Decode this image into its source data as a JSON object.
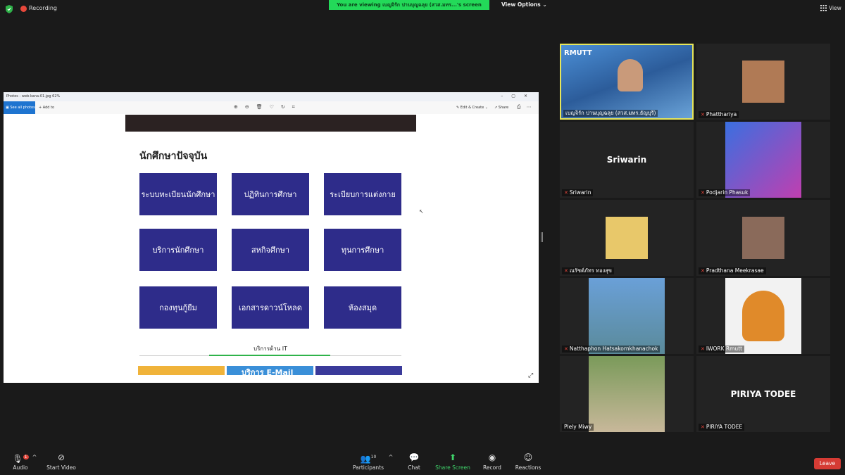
{
  "topbar": {
    "recording_label": "Recording",
    "viewing_text": "You are viewing เบญจิรัก ปานบุญฉลุย (สวส.มทร...'s screen",
    "view_options_label": "View Options",
    "view_label": "View"
  },
  "shared_window": {
    "title": "Photos - web-kana-01.jpg   62%",
    "toolbar": {
      "see_all_photos": "See all photos",
      "add_to": "Add to",
      "edit_create": "Edit & Create",
      "share": "Share"
    },
    "section_title": "นักศึกษาปัจจุบัน",
    "tiles": [
      "ระบบทะเบียนนักศึกษา",
      "ปฏิทินการศึกษา",
      "ระเบียบการแต่งกาย",
      "บริการนักศึกษา",
      "สหกิจศึกษา",
      "ทุนการศึกษา",
      "กองทุนกู้ยืม",
      "เอกสารดาวน์โหลด",
      "ห้องสมุด"
    ],
    "it_services_label": "บริการด้าน IT",
    "banner_text": "บริการ E-Mail"
  },
  "participants": [
    {
      "name": "เบญจิรัก ปานบุญฉลุย (สวส.มทร.ธัญบุรี)",
      "muted": false,
      "active": true
    },
    {
      "name": "Phatthariya",
      "muted": true
    },
    {
      "name": "Sriwarin",
      "muted": true,
      "display_name": "Sriwarin"
    },
    {
      "name": "Podjarin Phasuk",
      "muted": true
    },
    {
      "name": "ณรัชต์ภัทร  ทองสุข",
      "muted": true
    },
    {
      "name": "Pradthana Meekrasae",
      "muted": true
    },
    {
      "name": "Natthaphon Hatsakornkhanachok",
      "muted": true
    },
    {
      "name": "IWORK Rmutt",
      "muted": true
    },
    {
      "name": "Plely Miwy",
      "muted": false
    },
    {
      "name": "PIRIYA TODEE",
      "muted": true,
      "display_name": "PIRIYA TODEE"
    }
  ],
  "bottombar": {
    "audio": "Audio",
    "start_video": "Start Video",
    "participants": "Participants",
    "participants_count": "10",
    "chat": "Chat",
    "share_screen": "Share Screen",
    "record": "Record",
    "reactions": "Reactions",
    "leave": "Leave",
    "audio_badge": "1"
  },
  "colors": {
    "tile_blue": "#2e2c8a",
    "share_green": "#23d959",
    "leave_red": "#d63b34",
    "active_speaker": "#e6e65a"
  }
}
